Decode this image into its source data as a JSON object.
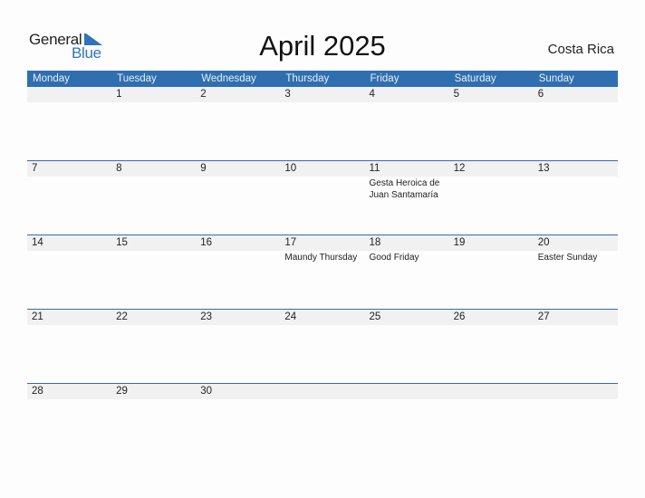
{
  "logo": {
    "general": "General",
    "blue": "Blue",
    "accent_color": "#2f74b8"
  },
  "title": "April 2025",
  "country": "Costa Rica",
  "header_color": "#2f6fb0",
  "weekdays": [
    "Monday",
    "Tuesday",
    "Wednesday",
    "Thursday",
    "Friday",
    "Saturday",
    "Sunday"
  ],
  "weeks": [
    [
      {
        "day": ""
      },
      {
        "day": "1"
      },
      {
        "day": "2"
      },
      {
        "day": "3"
      },
      {
        "day": "4"
      },
      {
        "day": "5"
      },
      {
        "day": "6"
      }
    ],
    [
      {
        "day": "7"
      },
      {
        "day": "8"
      },
      {
        "day": "9"
      },
      {
        "day": "10"
      },
      {
        "day": "11",
        "holiday": "Gesta Heroica de Juan Santamaría"
      },
      {
        "day": "12"
      },
      {
        "day": "13"
      }
    ],
    [
      {
        "day": "14"
      },
      {
        "day": "15"
      },
      {
        "day": "16"
      },
      {
        "day": "17",
        "holiday": "Maundy Thursday"
      },
      {
        "day": "18",
        "holiday": "Good Friday"
      },
      {
        "day": "19"
      },
      {
        "day": "20",
        "holiday": "Easter Sunday"
      }
    ],
    [
      {
        "day": "21"
      },
      {
        "day": "22"
      },
      {
        "day": "23"
      },
      {
        "day": "24"
      },
      {
        "day": "25"
      },
      {
        "day": "26"
      },
      {
        "day": "27"
      }
    ],
    [
      {
        "day": "28"
      },
      {
        "day": "29"
      },
      {
        "day": "30"
      },
      {
        "day": ""
      },
      {
        "day": ""
      },
      {
        "day": ""
      },
      {
        "day": ""
      }
    ]
  ]
}
